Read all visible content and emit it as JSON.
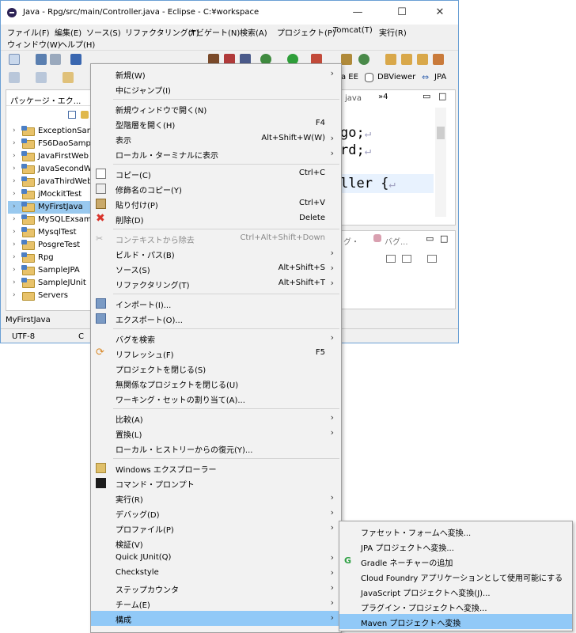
{
  "window": {
    "title": "Java - Rpg/src/main/Controller.java - Eclipse - C:¥workspace",
    "minimize": "—",
    "maximize": "☐",
    "close": "✕"
  },
  "menubar": [
    "ファイル(F)",
    "編集(E)",
    "ソース(S)",
    "リファクタリング(T)",
    "ナビゲート(N)",
    "検索(A)",
    "プロジェクト(P)",
    "Tomcat(T)",
    "実行(R)",
    "ウィンドウ(W)",
    "ヘルプ(H)"
  ],
  "perspectives": {
    "javaee": "a EE",
    "dbviewer": "DBViewer",
    "jpa": "JPA"
  },
  "explorer": {
    "tab_label": "パッケージ・エク...",
    "items": [
      "ExceptionSamp",
      "FS6DaoSample",
      "JavaFirstWeb",
      "JavaSecondWel",
      "JavaThirdWeb",
      "jMockitTest",
      "MyFirstJava",
      "MySQLExsampl",
      "MysqlTest",
      "PosgreTest",
      "Rpg",
      "SampleJPA",
      "SampleJUnit",
      "Servers"
    ]
  },
  "editor": {
    "tab_label": "java",
    "overflow": "»4",
    "lines": [
      "go;",
      "rd;",
      "ller {"
    ]
  },
  "lower_tabs": {
    "t1": "グ・",
    "t2": "バグ..."
  },
  "status": {
    "selection": "MyFirstJava",
    "encoding": "UTF-8",
    "extra": "C"
  },
  "context_menu": [
    {
      "label": "新規(W)",
      "shortcut": "",
      "submenu": true
    },
    {
      "label": "中にジャンプ(I)",
      "shortcut": "",
      "submenu": false
    },
    {
      "label": "新規ウィンドウで開く(N)",
      "shortcut": "",
      "submenu": false
    },
    {
      "label": "型階層を開く(H)",
      "shortcut": "F4",
      "submenu": false
    },
    {
      "label": "表示",
      "shortcut": "Alt+Shift+W(W)",
      "submenu": true
    },
    {
      "label": "ローカル・ターミナルに表示",
      "shortcut": "",
      "submenu": true
    },
    {
      "label": "コピー(C)",
      "shortcut": "Ctrl+C",
      "submenu": false
    },
    {
      "label": "修飾名のコピー(Y)",
      "shortcut": "",
      "submenu": false
    },
    {
      "label": "貼り付け(P)",
      "shortcut": "Ctrl+V",
      "submenu": false
    },
    {
      "label": "削除(D)",
      "shortcut": "Delete",
      "submenu": false
    },
    {
      "label": "コンテキストから除去",
      "shortcut": "Ctrl+Alt+Shift+Down",
      "submenu": false
    },
    {
      "label": "ビルド・パス(B)",
      "shortcut": "",
      "submenu": true
    },
    {
      "label": "ソース(S)",
      "shortcut": "Alt+Shift+S",
      "submenu": true
    },
    {
      "label": "リファクタリング(T)",
      "shortcut": "Alt+Shift+T",
      "submenu": true
    },
    {
      "label": "インポート(I)...",
      "shortcut": "",
      "submenu": false
    },
    {
      "label": "エクスポート(O)...",
      "shortcut": "",
      "submenu": false
    },
    {
      "label": "バグを検索",
      "shortcut": "",
      "submenu": true
    },
    {
      "label": "リフレッシュ(F)",
      "shortcut": "F5",
      "submenu": false
    },
    {
      "label": "プロジェクトを閉じる(S)",
      "shortcut": "",
      "submenu": false
    },
    {
      "label": "無関係なプロジェクトを閉じる(U)",
      "shortcut": "",
      "submenu": false
    },
    {
      "label": "ワーキング・セットの割り当て(A)...",
      "shortcut": "",
      "submenu": false
    },
    {
      "label": "比較(A)",
      "shortcut": "",
      "submenu": true
    },
    {
      "label": "置換(L)",
      "shortcut": "",
      "submenu": true
    },
    {
      "label": "ローカル・ヒストリーからの復元(Y)...",
      "shortcut": "",
      "submenu": false
    },
    {
      "label": "Windows エクスプローラー",
      "shortcut": "",
      "submenu": false
    },
    {
      "label": "コマンド・プロンプト",
      "shortcut": "",
      "submenu": false
    },
    {
      "label": "実行(R)",
      "shortcut": "",
      "submenu": true
    },
    {
      "label": "デバッグ(D)",
      "shortcut": "",
      "submenu": true
    },
    {
      "label": "プロファイル(P)",
      "shortcut": "",
      "submenu": true
    },
    {
      "label": "検証(V)",
      "shortcut": "",
      "submenu": false
    },
    {
      "label": "Quick JUnit(Q)",
      "shortcut": "",
      "submenu": true
    },
    {
      "label": "Checkstyle",
      "shortcut": "",
      "submenu": true
    },
    {
      "label": "ステップカウンタ",
      "shortcut": "",
      "submenu": true
    },
    {
      "label": "チーム(E)",
      "shortcut": "",
      "submenu": true
    },
    {
      "label": "構成",
      "shortcut": "",
      "submenu": true
    }
  ],
  "submenu": [
    "ファセット・フォームへ変換...",
    "JPA プロジェクトへ変換...",
    "Gradle ネーチャーの追加",
    "Cloud Foundry アプリケーションとして使用可能にする",
    "JavaScript プロジェクトへ変換(J)...",
    "プラグイン・プロジェクトへ変換...",
    "Maven プロジェクトへ変換"
  ],
  "glyphs": {
    "submenu_arrow": "›",
    "tree_arrow": "›",
    "return_mark": "↵",
    "gradle": "G"
  },
  "colors": {
    "selection": "#91c9f7",
    "tree_selection": "#99c9ef",
    "menu_bg": "#f2f2f2",
    "delete_icon": "#d9342b",
    "gradle_icon": "#2ea043"
  }
}
